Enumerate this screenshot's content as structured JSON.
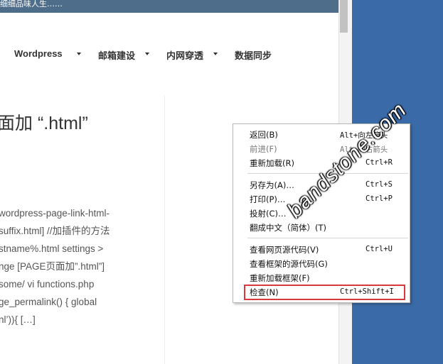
{
  "site": {
    "tagline": "细细品味人生……"
  },
  "nav": {
    "items": [
      {
        "label": "Wordpress"
      },
      {
        "label": "邮箱建设"
      },
      {
        "label": "内网穿透"
      },
      {
        "label": "数据同步"
      }
    ]
  },
  "post": {
    "title": "面加 “.html”",
    "excerpt_lines": [
      "wordpress-page-link-html-",
      "suffix.html] //加插件的方法",
      "stname%.html settings >",
      "nge [PAGE页面加”.html”]",
      "some/ vi functions.php",
      "ge_permalink() {    global",
      "nl’)){   […]"
    ]
  },
  "context_menu": {
    "items": [
      {
        "label": "返回(B)",
        "shortcut": "Alt+向左箭头",
        "disabled": false
      },
      {
        "label": "前进(F)",
        "shortcut": "Alt+向右箭头",
        "disabled": true
      },
      {
        "label": "重新加载(R)",
        "shortcut": "Ctrl+R",
        "disabled": false
      },
      {
        "label": "另存为(A)…",
        "shortcut": "Ctrl+S",
        "disabled": false
      },
      {
        "label": "打印(P)…",
        "shortcut": "Ctrl+P",
        "disabled": false
      },
      {
        "label": "投射(C)…",
        "shortcut": "",
        "disabled": false
      },
      {
        "label": "翻成中文（简体）(T)",
        "shortcut": "",
        "disabled": false
      },
      {
        "label": "查看网页源代码(V)",
        "shortcut": "Ctrl+U",
        "disabled": false
      },
      {
        "label": "查看框架的源代码(G)",
        "shortcut": "",
        "disabled": false
      },
      {
        "label": "重新加载框架(F)",
        "shortcut": "",
        "disabled": false
      },
      {
        "label": "检查(N)",
        "shortcut": "Ctrl+Shift+I",
        "disabled": false
      }
    ],
    "highlight_color": "#d9393a"
  },
  "watermark": {
    "text": "bandstone.com"
  }
}
